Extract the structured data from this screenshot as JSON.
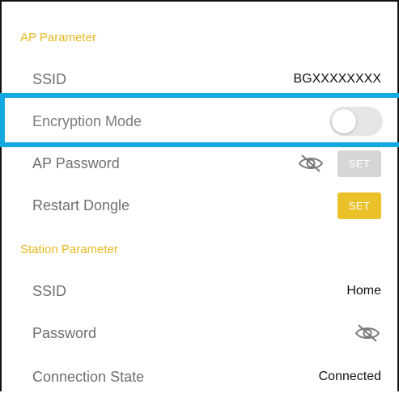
{
  "ap": {
    "section_title": "AP Parameter",
    "ssid_label": "SSID",
    "ssid_value": "BGXXXXXXXX",
    "encryption_label": "Encryption Mode",
    "encryption_enabled": false,
    "password_label": "AP Password",
    "password_set_label": "SET",
    "restart_label": "Restart Dongle",
    "restart_set_label": "SET"
  },
  "station": {
    "section_title": "Station Parameter",
    "ssid_label": "SSID",
    "ssid_value": "Home",
    "password_label": "Password",
    "connection_label": "Connection State",
    "connection_value": "Connected"
  },
  "colors": {
    "accent": "#E8B923",
    "highlight": "#15A7E0",
    "button_active": "#EBC12A",
    "button_disabled": "#D6D6D6"
  },
  "icons": [
    "eye-off-icon"
  ]
}
